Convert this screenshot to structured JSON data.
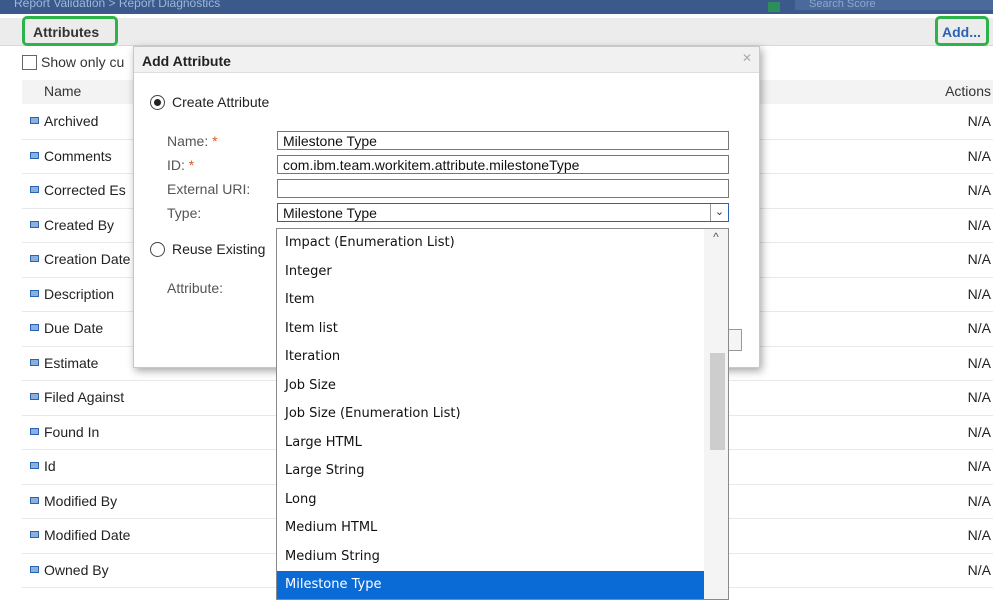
{
  "topbar": {
    "breadcrumb": "Report Validation  >  Report Diagnostics",
    "search_placeholder": "Search Score"
  },
  "attributes_panel": {
    "title": "Attributes",
    "add_label": "Add...",
    "filter_label": "Show only cu",
    "columns": {
      "name": "Name",
      "actions": "Actions"
    },
    "rows": [
      {
        "name": "Archived",
        "action": "N/A"
      },
      {
        "name": "Comments",
        "action": "N/A"
      },
      {
        "name": "Corrected Es",
        "action": "N/A"
      },
      {
        "name": "Created By",
        "action": "N/A"
      },
      {
        "name": "Creation Date",
        "action": "N/A"
      },
      {
        "name": "Description",
        "action": "N/A"
      },
      {
        "name": "Due Date",
        "action": "N/A"
      },
      {
        "name": "Estimate",
        "action": "N/A"
      },
      {
        "name": "Filed Against",
        "action": "N/A"
      },
      {
        "name": "Found In",
        "action": "N/A"
      },
      {
        "name": "Id",
        "action": "N/A"
      },
      {
        "name": "Modified By",
        "action": "N/A"
      },
      {
        "name": "Modified Date",
        "action": "N/A"
      },
      {
        "name": "Owned By",
        "action": "N/A"
      }
    ]
  },
  "dialog": {
    "title": "Add Attribute",
    "create_option": "Create Attribute",
    "reuse_option": "Reuse Existing",
    "fields": {
      "name_label": "Name:",
      "name_value": "Milestone Type",
      "id_label": "ID:",
      "id_value": "com.ibm.team.workitem.attribute.milestoneType",
      "uri_label": "External URI:",
      "uri_value": "",
      "type_label": "Type:",
      "type_value": "Milestone Type",
      "attribute_label": "Attribute:"
    },
    "required_marker": "*"
  },
  "type_dropdown": {
    "options": [
      "Impact (Enumeration List)",
      "Integer",
      "Item",
      "Item list",
      "Iteration",
      "Job Size",
      "Job Size (Enumeration List)",
      "Large HTML",
      "Large String",
      "Long",
      "Medium HTML",
      "Medium String",
      "Milestone Type"
    ],
    "selected": "Milestone Type",
    "selected_color": "#0a6ad6"
  }
}
